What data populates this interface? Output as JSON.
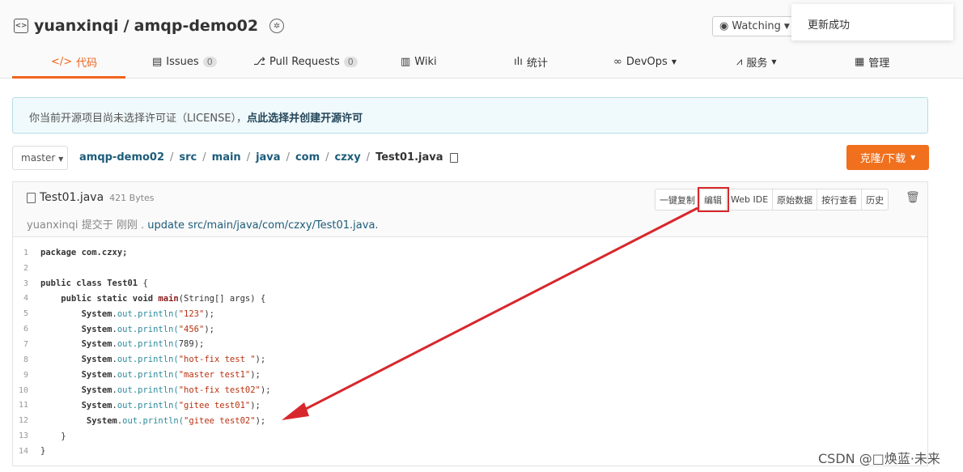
{
  "repo": {
    "owner": "yuanxinqi",
    "separator": "/",
    "name": "amqp-demo02"
  },
  "watch": {
    "label": "Watching"
  },
  "toast": {
    "text": "更新成功"
  },
  "tabs": [
    {
      "icon": "</>",
      "label": "代码",
      "active": true
    },
    {
      "icon": "▤",
      "label": "Issues",
      "count": "0"
    },
    {
      "icon": "⎇",
      "label": "Pull Requests",
      "count": "0"
    },
    {
      "icon": "▥",
      "label": "Wiki"
    },
    {
      "icon": "ılı",
      "label": "统计"
    },
    {
      "icon": "∞",
      "label": "DevOps"
    },
    {
      "icon": "⩘",
      "label": "服务"
    },
    {
      "icon": "▦",
      "label": "管理"
    }
  ],
  "license": {
    "text": "你当前开源项目尚未选择许可证（LICENSE），",
    "link": "点此选择并创建开源许可"
  },
  "branch": {
    "value": "master"
  },
  "breadcrumb": [
    "amqp-demo02",
    "src",
    "main",
    "java",
    "com",
    "czxy",
    "Test01.java"
  ],
  "clone_button": {
    "label": "克隆/下载"
  },
  "file": {
    "name": "Test01.java",
    "size": "421 Bytes",
    "commit_author": "yuanxinqi",
    "commit_text": "提交于 刚刚 .",
    "commit_message": "update src/main/java/com/czxy/Test01.java.",
    "buttons": [
      "一键复制",
      "编辑",
      "Web IDE",
      "原始数据",
      "按行查看",
      "历史"
    ]
  },
  "code_lines": [
    "1",
    "2",
    "3",
    "4",
    "5",
    "6",
    "7",
    "8",
    "9",
    "10",
    "11",
    "12",
    "13",
    "14"
  ],
  "code": {
    "l1_kw": "package",
    "l1_rest": "com.czxy;",
    "l3_kw": "public class",
    "l3_cls": "Test01",
    "l3_rest": " {",
    "l4_kw": "public static void",
    "l4_fn": "main",
    "l4_rest": "(String[] args) {",
    "system": "System",
    "out": "out",
    "println": ".println(",
    "s5": "\"123\"",
    "s6": "\"456\"",
    "s7": "789",
    "s8": "\"hot-fix test \"",
    "s9": "\"master test1\"",
    "s10": "\"hot-fix test02\"",
    "s11": "\"gitee test01\"",
    "s12": "\"gitee test02\"",
    "close_paren": ");",
    "close_brace": "}"
  },
  "watermark": "CSDN @□焕蓝·未来",
  "colors": {
    "accent": "#f0641e",
    "highlight": "#d8272c"
  }
}
